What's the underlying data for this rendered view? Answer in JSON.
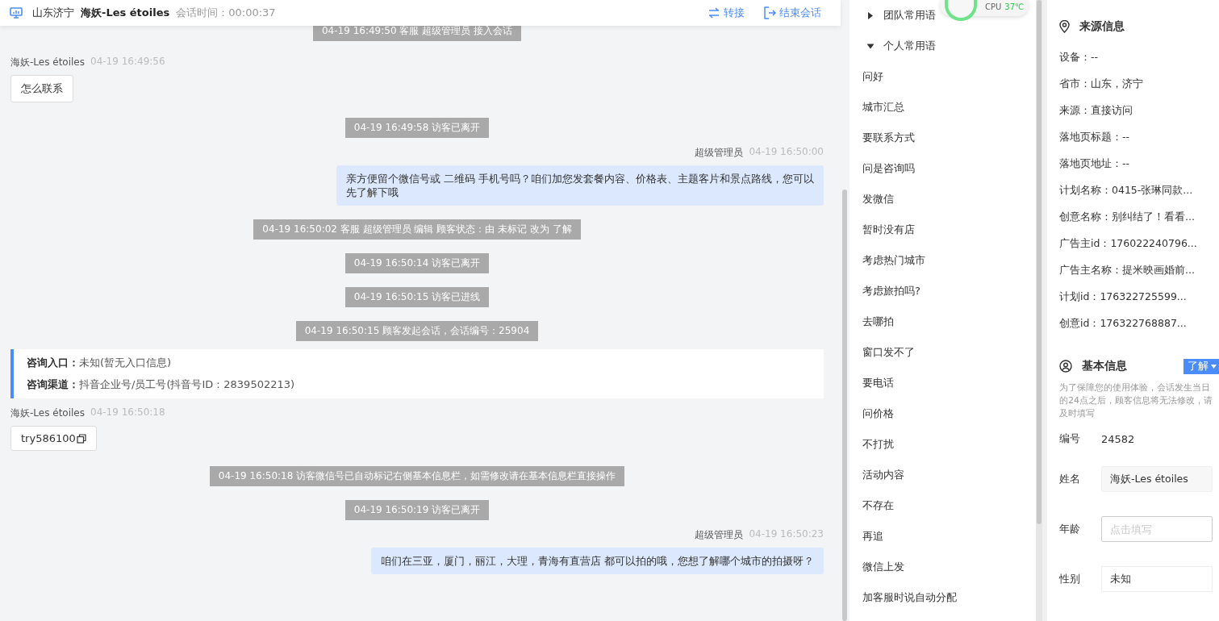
{
  "header": {
    "region": "山东济宁",
    "visitor": "海妖-Les étoiles",
    "session_time": "会话时间：00:00:37",
    "actions": [
      {
        "kind": "transfer",
        "label": "转接"
      },
      {
        "kind": "end",
        "label": "结束会话"
      }
    ]
  },
  "messages": [
    {
      "kind": "system",
      "text": "04-19 16:49:50 客服 超级管理员 接入会话"
    },
    {
      "kind": "visitor",
      "name": "海妖-Les étoiles",
      "time": "04-19 16:49:56",
      "text": "怎么联系",
      "copyable": false
    },
    {
      "kind": "system",
      "text": "04-19 16:49:58 访客已离开"
    },
    {
      "kind": "agent",
      "name": "超级管理员",
      "time": "04-19 16:50:00",
      "text": "亲方便留个微信号或 二维码 手机号吗？咱们加您发套餐内容、价格表、主题客片和景点路线，您可以先了解下哦"
    },
    {
      "kind": "system",
      "text": "04-19 16:50:02 客服 超级管理员 编辑 顾客状态：由 未标记 改为 了解"
    },
    {
      "kind": "system",
      "text": "04-19 16:50:14 访客已离开"
    },
    {
      "kind": "system",
      "text": "04-19 16:50:15 访客已进线"
    },
    {
      "kind": "system",
      "text": "04-19 16:50:15 顾客发起会话，会话编号：25904"
    },
    {
      "kind": "info",
      "rows": [
        {
          "label": "咨询入口：",
          "value": "未知(暂无入口信息)"
        },
        {
          "label": "咨询渠道：",
          "value": "抖音企业号/员工号(抖音号ID：2839502213)"
        }
      ]
    },
    {
      "kind": "visitor",
      "name": "海妖-Les étoiles",
      "time": "04-19 16:50:18",
      "text": "try586100",
      "copyable": true
    },
    {
      "kind": "system",
      "text": "04-19 16:50:18 访客微信号已自动标记右侧基本信息栏，如需修改请在基本信息栏直接操作"
    },
    {
      "kind": "system",
      "text": "04-19 16:50:19 访客已离开"
    },
    {
      "kind": "agent",
      "name": "超级管理员",
      "time": "04-19 16:50:23",
      "text": "咱们在三亚，厦门，丽江，大理，青海有直营店 都可以拍的哦，您想了解哪个城市的拍摄呀？"
    }
  ],
  "phrases": [
    {
      "title": "团队常用语",
      "expanded": false
    },
    {
      "title": "个人常用语",
      "expanded": true,
      "items": [
        "问好",
        "城市汇总",
        "要联系方式",
        "问是咨询吗",
        "发微信",
        "暂时没有店",
        "考虑热门城市",
        "考虑旅拍吗?",
        "去哪拍",
        "窗口发不了",
        "要电话",
        "问价格",
        "不打扰",
        "活动内容",
        "不存在",
        "再追",
        "微信上发",
        "加客服时说自动分配"
      ]
    }
  ],
  "cpu_widget": {
    "label": "CPU",
    "temperature": "37℃"
  },
  "source_info": {
    "title": "来源信息",
    "rows": [
      "设备：--",
      "省市：山东，济宁",
      "来源：直接访问",
      "落地页标题：--",
      "落地页地址：--",
      "计划名称：0415-张琳同款...",
      "创意名称：别纠结了！看看...",
      "广告主id：176022240796...",
      "广告主名称：提米映画婚前...",
      "计划id：176322725599...",
      "创意id：176322768887..."
    ]
  },
  "basic_info": {
    "title": "基本信息",
    "status": "了解",
    "note": "为了保障您的使用体验，会话发生当日的24点之后，顾客信息将无法修改，请及时填写",
    "fields": [
      {
        "kind": "text",
        "label": "编号",
        "value": "24582"
      },
      {
        "kind": "input",
        "label": "姓名",
        "value": "海妖-Les étoiles"
      },
      {
        "kind": "input",
        "label": "年龄",
        "placeholder": "点击填写"
      },
      {
        "kind": "select",
        "label": "性别",
        "value": "未知"
      }
    ]
  }
}
